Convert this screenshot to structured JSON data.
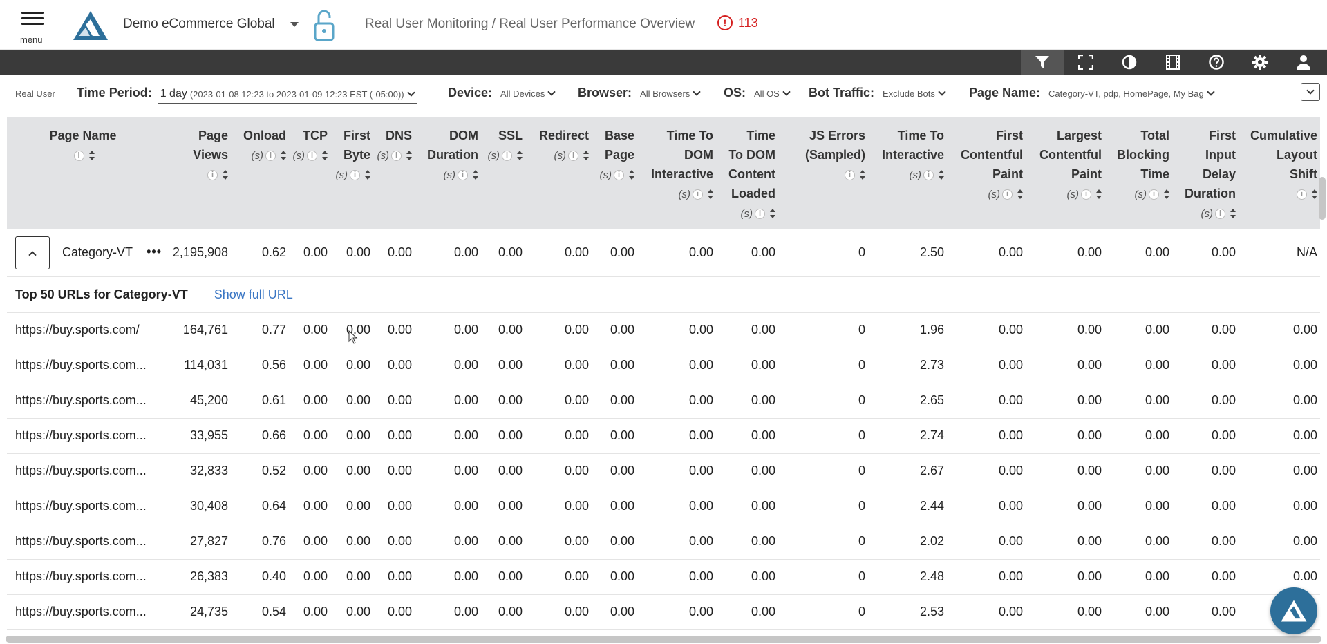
{
  "header": {
    "menu_label": "menu",
    "app_name": "Demo eCommerce Global",
    "breadcrumb": "Real User Monitoring / Real User Performance Overview",
    "alert_count": "113",
    "alert_icon": "!"
  },
  "toolbar": {
    "icons": [
      "filter-icon",
      "fullscreen-icon",
      "contrast-icon",
      "film-icon",
      "help-icon",
      "settings-icon",
      "user-icon"
    ]
  },
  "filters": {
    "context": "Real User",
    "time_period_label": "Time Period:",
    "time_period_value_main": "1 day",
    "time_period_value_detail": "(2023-01-08 12:23 to 2023-01-09 12:23 EST (-05:00))",
    "device_label": "Device:",
    "device_value": "All Devices",
    "browser_label": "Browser:",
    "browser_value": "All Browsers",
    "os_label": "OS:",
    "os_value": "All OS",
    "bot_label": "Bot Traffic:",
    "bot_value": "Exclude Bots",
    "page_name_label": "Page Name:",
    "page_name_value": "Category-VT, pdp, HomePage, My Bag"
  },
  "table": {
    "columns": [
      {
        "l1": "Page Name",
        "l2": "",
        "unit": ""
      },
      {
        "l1": "Page",
        "l2": "Views",
        "unit": ""
      },
      {
        "l1": "Onload",
        "l2": "",
        "unit": "(s)"
      },
      {
        "l1": "TCP",
        "l2": "",
        "unit": "(s)"
      },
      {
        "l1": "First",
        "l2": "Byte",
        "unit": "(s)"
      },
      {
        "l1": "DNS",
        "l2": "",
        "unit": "(s)"
      },
      {
        "l1": "DOM",
        "l2": "Duration",
        "unit": "(s)"
      },
      {
        "l1": "SSL",
        "l2": "",
        "unit": "(s)"
      },
      {
        "l1": "Redirect",
        "l2": "",
        "unit": "(s)"
      },
      {
        "l1": "Base",
        "l2": "Page",
        "unit": "(s)"
      },
      {
        "l1": "Time To",
        "l2": "DOM",
        "l3": "Interactive",
        "unit": "(s)"
      },
      {
        "l1": "Time",
        "l2": "To DOM",
        "l3": "Content",
        "l4": "Loaded",
        "unit": "(s)"
      },
      {
        "l1": "JS Errors",
        "l2": "(Sampled)",
        "unit": ""
      },
      {
        "l1": "Time To",
        "l2": "Interactive",
        "unit": "(s)"
      },
      {
        "l1": "First",
        "l2": "Contentful",
        "l3": "Paint",
        "unit": "(s)"
      },
      {
        "l1": "Largest",
        "l2": "Contentful",
        "l3": "Paint",
        "unit": "(s)"
      },
      {
        "l1": "Total",
        "l2": "Blocking",
        "l3": "Time",
        "unit": "(s)"
      },
      {
        "l1": "First",
        "l2": "Input",
        "l3": "Delay",
        "l4": "Duration",
        "unit": "(s)"
      },
      {
        "l1": "Cumulative",
        "l2": "Layout",
        "l3": "Shift",
        "unit": ""
      }
    ],
    "group": {
      "name": "Category-VT",
      "values": [
        "2,195,908",
        "0.62",
        "0.00",
        "0.00",
        "0.00",
        "0.00",
        "0.00",
        "0.00",
        "0.00",
        "0.00",
        "0.00",
        "0",
        "2.50",
        "0.00",
        "0.00",
        "0.00",
        "0.00",
        "N/A"
      ]
    },
    "sub_title": "Top 50 URLs for Category-VT",
    "show_full_url": "Show full URL",
    "rows": [
      {
        "url": "https://buy.sports.com/",
        "values": [
          "164,761",
          "0.77",
          "0.00",
          "0.00",
          "0.00",
          "0.00",
          "0.00",
          "0.00",
          "0.00",
          "0.00",
          "0.00",
          "0",
          "1.96",
          "0.00",
          "0.00",
          "0.00",
          "0.00",
          "0.00"
        ]
      },
      {
        "url": "https://buy.sports.com...",
        "values": [
          "114,031",
          "0.56",
          "0.00",
          "0.00",
          "0.00",
          "0.00",
          "0.00",
          "0.00",
          "0.00",
          "0.00",
          "0.00",
          "0",
          "2.73",
          "0.00",
          "0.00",
          "0.00",
          "0.00",
          "0.00"
        ]
      },
      {
        "url": "https://buy.sports.com...",
        "values": [
          "45,200",
          "0.61",
          "0.00",
          "0.00",
          "0.00",
          "0.00",
          "0.00",
          "0.00",
          "0.00",
          "0.00",
          "0.00",
          "0",
          "2.65",
          "0.00",
          "0.00",
          "0.00",
          "0.00",
          "0.00"
        ]
      },
      {
        "url": "https://buy.sports.com...",
        "values": [
          "33,955",
          "0.66",
          "0.00",
          "0.00",
          "0.00",
          "0.00",
          "0.00",
          "0.00",
          "0.00",
          "0.00",
          "0.00",
          "0",
          "2.74",
          "0.00",
          "0.00",
          "0.00",
          "0.00",
          "0.00"
        ]
      },
      {
        "url": "https://buy.sports.com...",
        "values": [
          "32,833",
          "0.52",
          "0.00",
          "0.00",
          "0.00",
          "0.00",
          "0.00",
          "0.00",
          "0.00",
          "0.00",
          "0.00",
          "0",
          "2.67",
          "0.00",
          "0.00",
          "0.00",
          "0.00",
          "0.00"
        ]
      },
      {
        "url": "https://buy.sports.com...",
        "values": [
          "30,408",
          "0.64",
          "0.00",
          "0.00",
          "0.00",
          "0.00",
          "0.00",
          "0.00",
          "0.00",
          "0.00",
          "0.00",
          "0",
          "2.44",
          "0.00",
          "0.00",
          "0.00",
          "0.00",
          "0.00"
        ]
      },
      {
        "url": "https://buy.sports.com...",
        "values": [
          "27,827",
          "0.76",
          "0.00",
          "0.00",
          "0.00",
          "0.00",
          "0.00",
          "0.00",
          "0.00",
          "0.00",
          "0.00",
          "0",
          "2.02",
          "0.00",
          "0.00",
          "0.00",
          "0.00",
          "0.00"
        ]
      },
      {
        "url": "https://buy.sports.com...",
        "values": [
          "26,383",
          "0.40",
          "0.00",
          "0.00",
          "0.00",
          "0.00",
          "0.00",
          "0.00",
          "0.00",
          "0.00",
          "0.00",
          "0",
          "2.48",
          "0.00",
          "0.00",
          "0.00",
          "0.00",
          "0.00"
        ]
      },
      {
        "url": "https://buy.sports.com...",
        "values": [
          "24,735",
          "0.54",
          "0.00",
          "0.00",
          "0.00",
          "0.00",
          "0.00",
          "0.00",
          "0.00",
          "0.00",
          "0.00",
          "0",
          "2.53",
          "0.00",
          "0.00",
          "0.00",
          "0.00",
          "0.00"
        ]
      }
    ]
  },
  "colors": {
    "toolbar_bg": "#3a3a3a",
    "header_bg": "#e2e3e5",
    "alert": "#d51f1f",
    "link": "#3a76c4",
    "brand": "#2d6f9a"
  }
}
